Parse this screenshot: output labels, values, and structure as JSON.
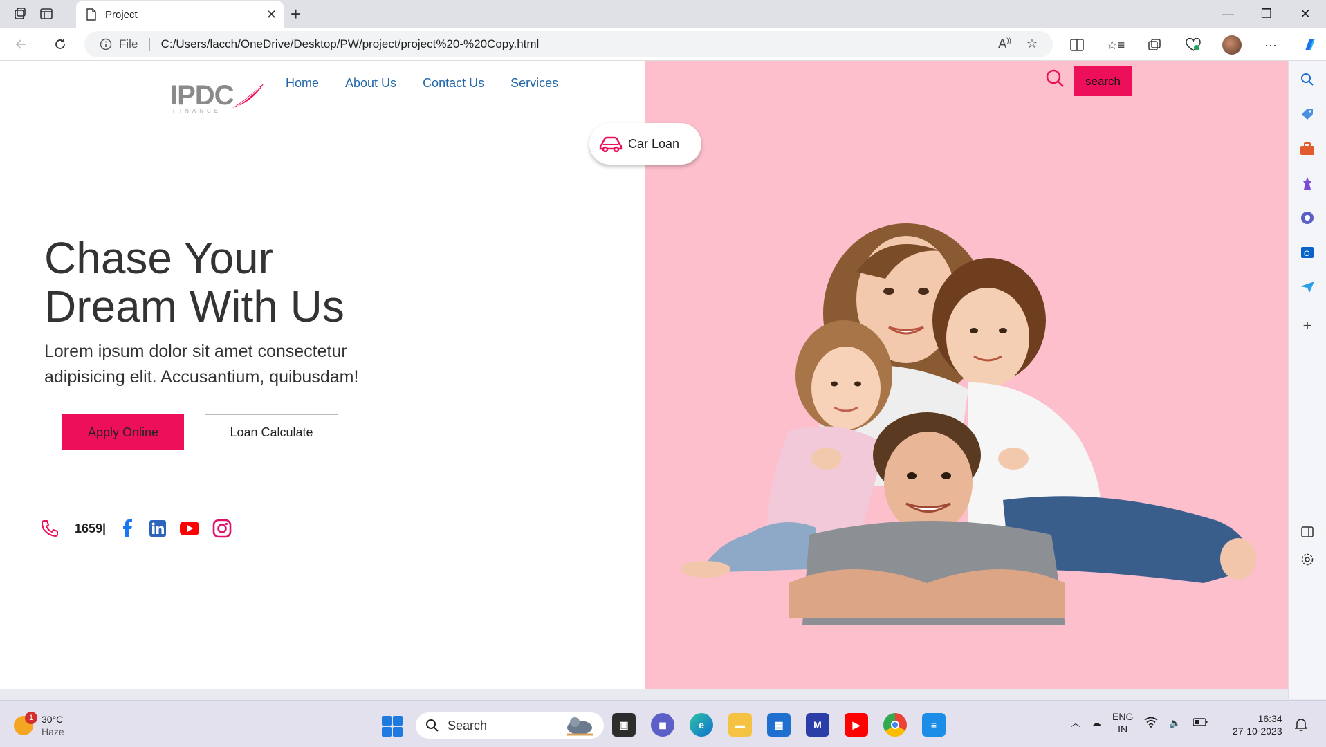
{
  "browser": {
    "tab_title": "Project",
    "file_label": "File",
    "url": "C:/Users/lacch/OneDrive/Desktop/PW/project/project%20-%20Copy.html"
  },
  "site": {
    "logo_text": "IPDC",
    "logo_sub": "FINANCE",
    "nav": [
      "Home",
      "About Us",
      "Contact Us",
      "Services"
    ],
    "search_label": "search",
    "car_loan_label": "Car Loan",
    "hero_title_line1": "Chase Your",
    "hero_title_line2": "Dream With Us",
    "hero_text": "Lorem ipsum dolor sit amet consectetur adipisicing elit. Accusantium, quibusdam!",
    "apply_label": "Apply Online",
    "calc_label": "Loan Calculate",
    "phone_number": "1659|",
    "accent": "#ee0f5b",
    "panel_color": "#fdbfcb",
    "link_color": "#2166a8"
  },
  "taskbar": {
    "weather_temp": "30°C",
    "weather_cond": "Haze",
    "weather_badge": "1",
    "search_label": "Search",
    "lang_line1": "ENG",
    "lang_line2": "IN",
    "time": "16:34",
    "date": "27-10-2023"
  }
}
